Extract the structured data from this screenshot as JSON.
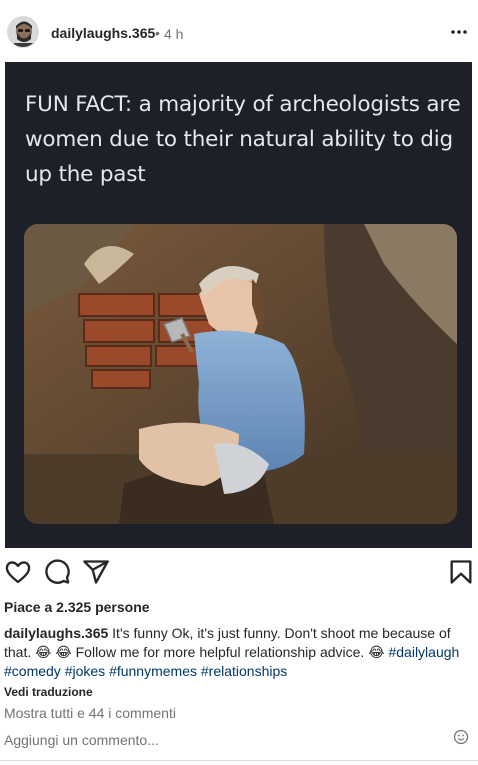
{
  "post": {
    "username": "dailylaughs.365",
    "separator": "•",
    "time": "4 h"
  },
  "image": {
    "meme_text": "FUN FACT: a majority of archeologists are women due to their natural ability to dig up the past"
  },
  "likes": "Piace a 2.325 persone",
  "caption": {
    "username": "dailylaughs.365",
    "text": "It's funny Ok, it's just funny. Don't shoot me because of that. 😂 😂  Follow me for more helpful relationship advice. 😂",
    "hashtags": [
      "#dailylaugh",
      "#comedy",
      "#jokes",
      "#funnymemes",
      "#relationships"
    ]
  },
  "translate_label": "Vedi traduzione",
  "comments_link": "Mostra tutti e 44 i commenti",
  "comment_placeholder": "Aggiungi un commento...",
  "icons": {
    "like": "heart-icon",
    "comment": "comment-icon",
    "share": "share-icon",
    "save": "bookmark-icon",
    "more": "more-icon",
    "emoji": "emoji-icon"
  }
}
